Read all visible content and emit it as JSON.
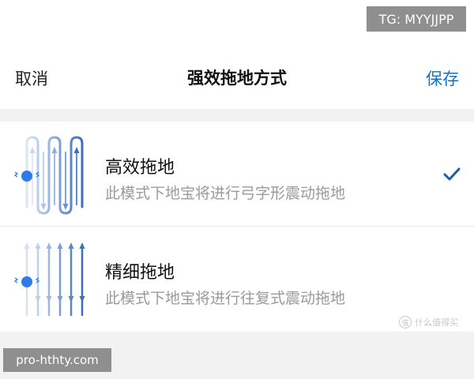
{
  "watermark_top": "TG: MYYJJPP",
  "header": {
    "cancel_label": "取消",
    "title": "强效拖地方式",
    "save_label": "保存"
  },
  "options": [
    {
      "title": "高效拖地",
      "description": "此模式下地宝将进行弓字形震动拖地",
      "selected": true,
      "icon": "zigzag-mop-path-icon"
    },
    {
      "title": "精细拖地",
      "description": "此模式下地宝将进行往复式震动拖地",
      "selected": false,
      "icon": "back-and-forth-mop-path-icon"
    }
  ],
  "site_mark": "什么值得买",
  "watermark_bottom": "pro-hthty.com",
  "colors": {
    "accent": "#1b6fc1",
    "path_dark": "#3d6fbf",
    "path_light": "#c3d3ec",
    "robot_dot": "#2f7be8"
  }
}
